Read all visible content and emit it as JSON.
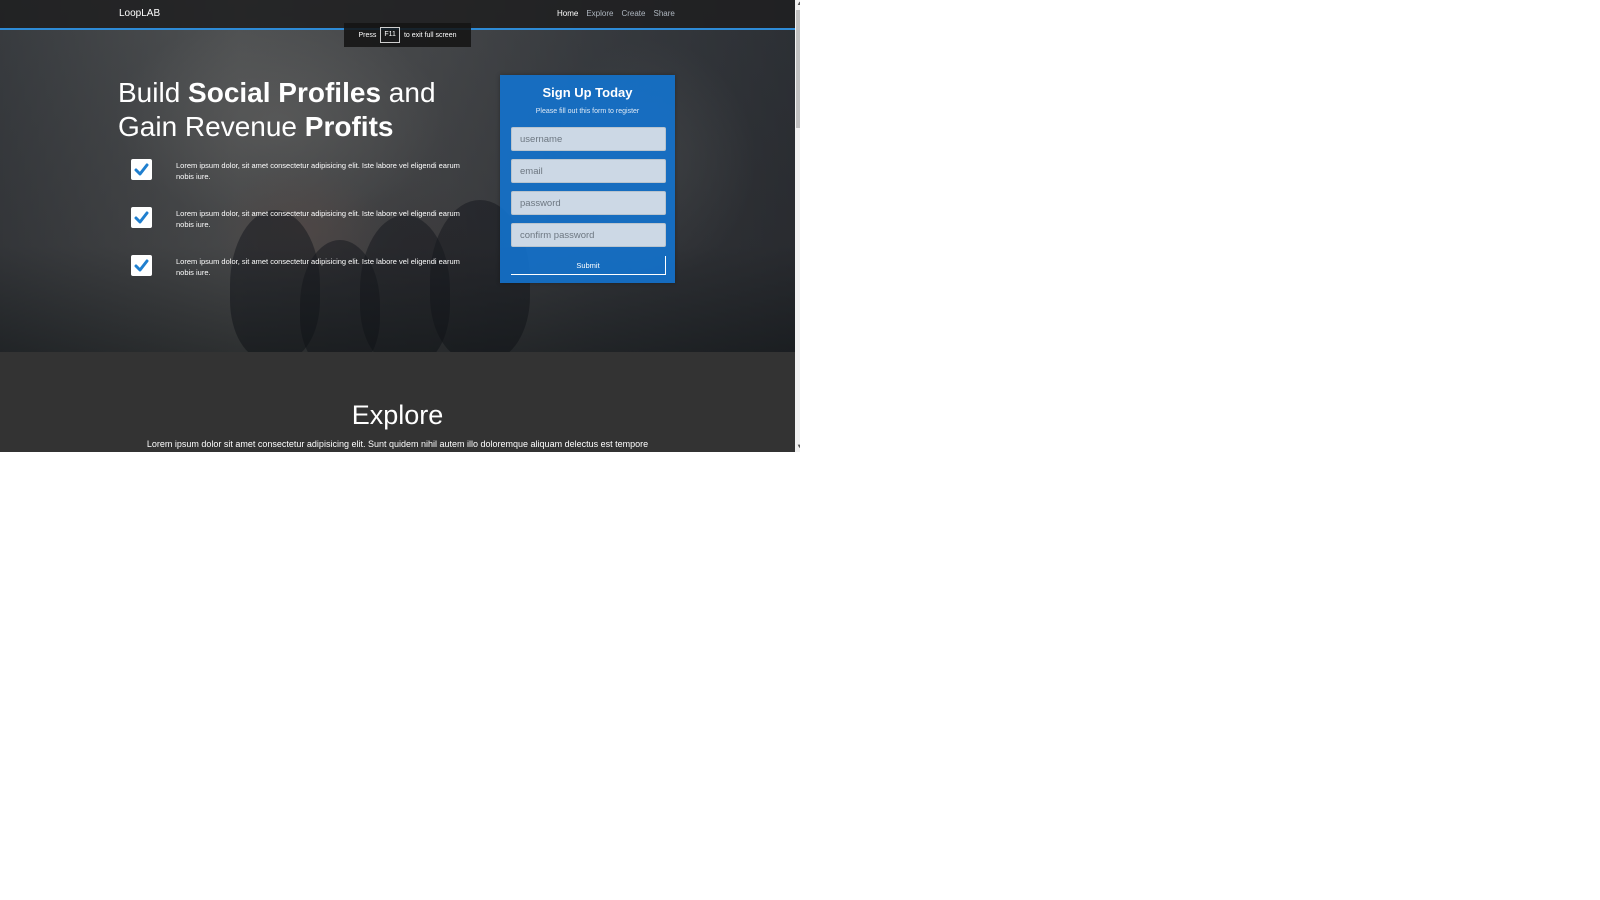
{
  "navbar": {
    "brand": "LoopLAB",
    "links": [
      "Home",
      "Explore",
      "Create",
      "Share"
    ],
    "active": "Home"
  },
  "fullscreen_notice": {
    "before": "Press",
    "key": "F11",
    "after": "to exit full screen"
  },
  "hero": {
    "headline_parts": [
      {
        "text": "Build ",
        "bold": false
      },
      {
        "text": "Social Profiles",
        "bold": true
      },
      {
        "text": " and Gain Revenue ",
        "bold": false
      },
      {
        "text": "Profits",
        "bold": true
      }
    ],
    "features": [
      "Lorem ipsum dolor, sit amet consectetur adipisicing elit. Iste labore vel eligendi earum nobis iure.",
      "Lorem ipsum dolor, sit amet consectetur adipisicing elit. Iste labore vel eligendi earum nobis iure.",
      "Lorem ipsum dolor, sit amet consectetur adipisicing elit. Iste labore vel eligendi earum nobis iure."
    ]
  },
  "signup": {
    "title": "Sign Up Today",
    "subtitle": "Please fill out this form to register",
    "fields": {
      "username_placeholder": "username",
      "email_placeholder": "email",
      "password_placeholder": "password",
      "confirm_placeholder": "confirm password"
    },
    "submit_label": "Submit"
  },
  "explore": {
    "title": "Explore",
    "text": "Lorem ipsum dolor sit amet consectetur adipisicing elit. Sunt quidem nihil autem illo doloremque aliquam delectus est tempore"
  },
  "colors": {
    "accent": "#2e8bd6",
    "signup_bg": "#1274d2",
    "check": "#1f7fcf",
    "section_bg": "#333333"
  },
  "icons": {
    "feature_check": "check-icon",
    "scroll_up": "chevron-up-icon",
    "scroll_down": "chevron-down-icon"
  }
}
